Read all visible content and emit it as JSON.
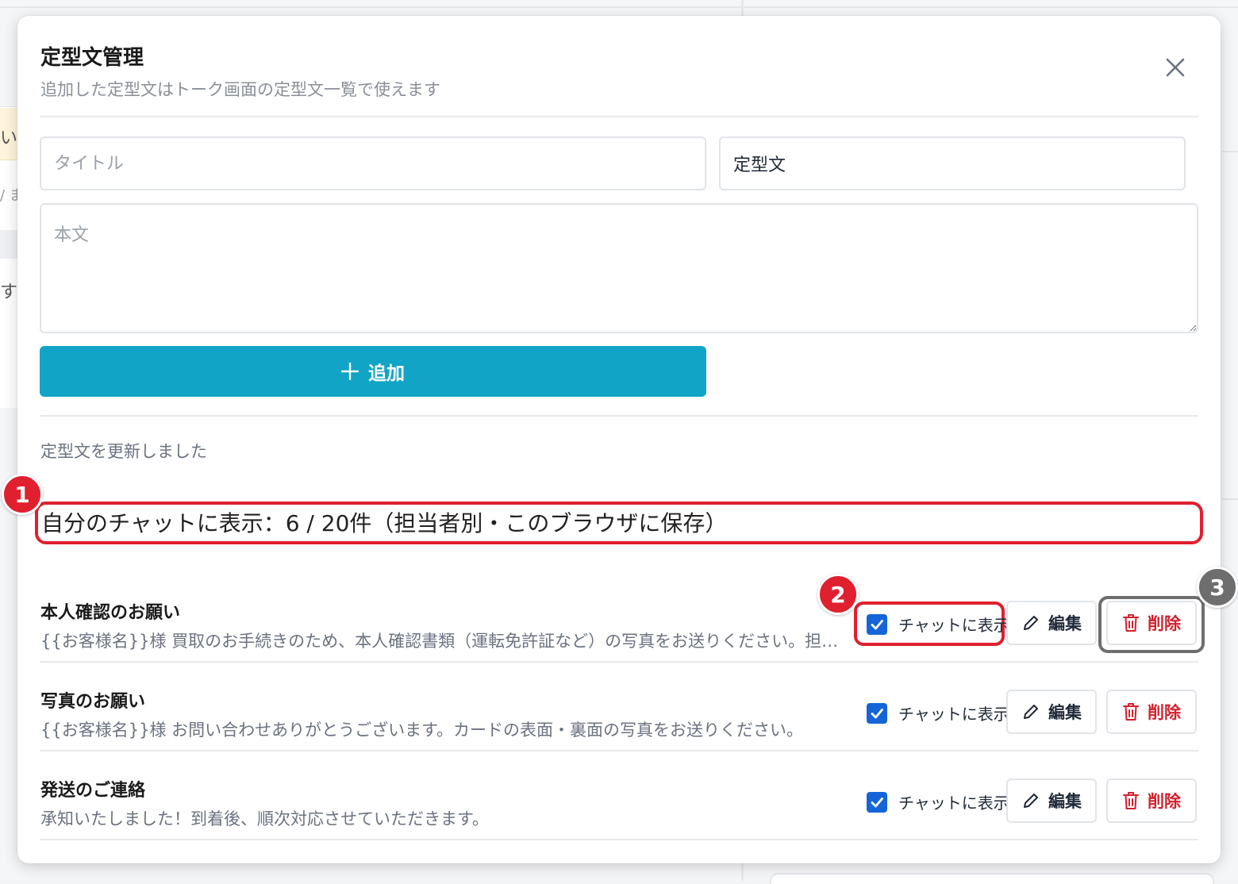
{
  "modal": {
    "title": "定型文管理",
    "subtitle": "追加した定型文はトーク画面の定型文一覧で使えます",
    "close_icon": "close-icon"
  },
  "form": {
    "title_placeholder": "タイトル",
    "category_value": "定型文",
    "body_placeholder": "本文",
    "add_label": "追加",
    "add_icon": "plus-icon"
  },
  "status_message": "定型文を更新しました",
  "count_summary": "自分のチャットに表示：6 / 20件（担当者別・このブラウザに保存）",
  "annotations": [
    "1",
    "2",
    "3"
  ],
  "templates": [
    {
      "title": "本人確認のお願い",
      "body": "{{お客様名}}様 買取のお手続きのため、本人確認書類（運転免許証など）の写真をお送りください。担当者より確認後ご連絡いたします。",
      "show_in_chat": true
    },
    {
      "title": "写真のお願い",
      "body": "{{お客様名}}様 お問い合わせありがとうございます。カードの表面・裏面の写真をお送りください。",
      "show_in_chat": true
    },
    {
      "title": "発送のご連絡",
      "body": "承知いたしました！到着後、順次対応させていただきます。",
      "show_in_chat": true
    }
  ],
  "row_actions": {
    "show_in_chat_label": "チャットに表示",
    "edit_label": "編集",
    "delete_label": "削除",
    "edit_icon": "pencil-icon",
    "delete_icon": "trash-icon"
  },
  "background": {
    "left_fragments": [
      "い。",
      "/ ま",
      "す"
    ]
  },
  "colors": {
    "accent": "#12a4c6",
    "checkbox": "#1565d8",
    "danger": "#d4202c",
    "annotation_red": "#e0202e",
    "annotation_gray": "#6e6e6e"
  }
}
